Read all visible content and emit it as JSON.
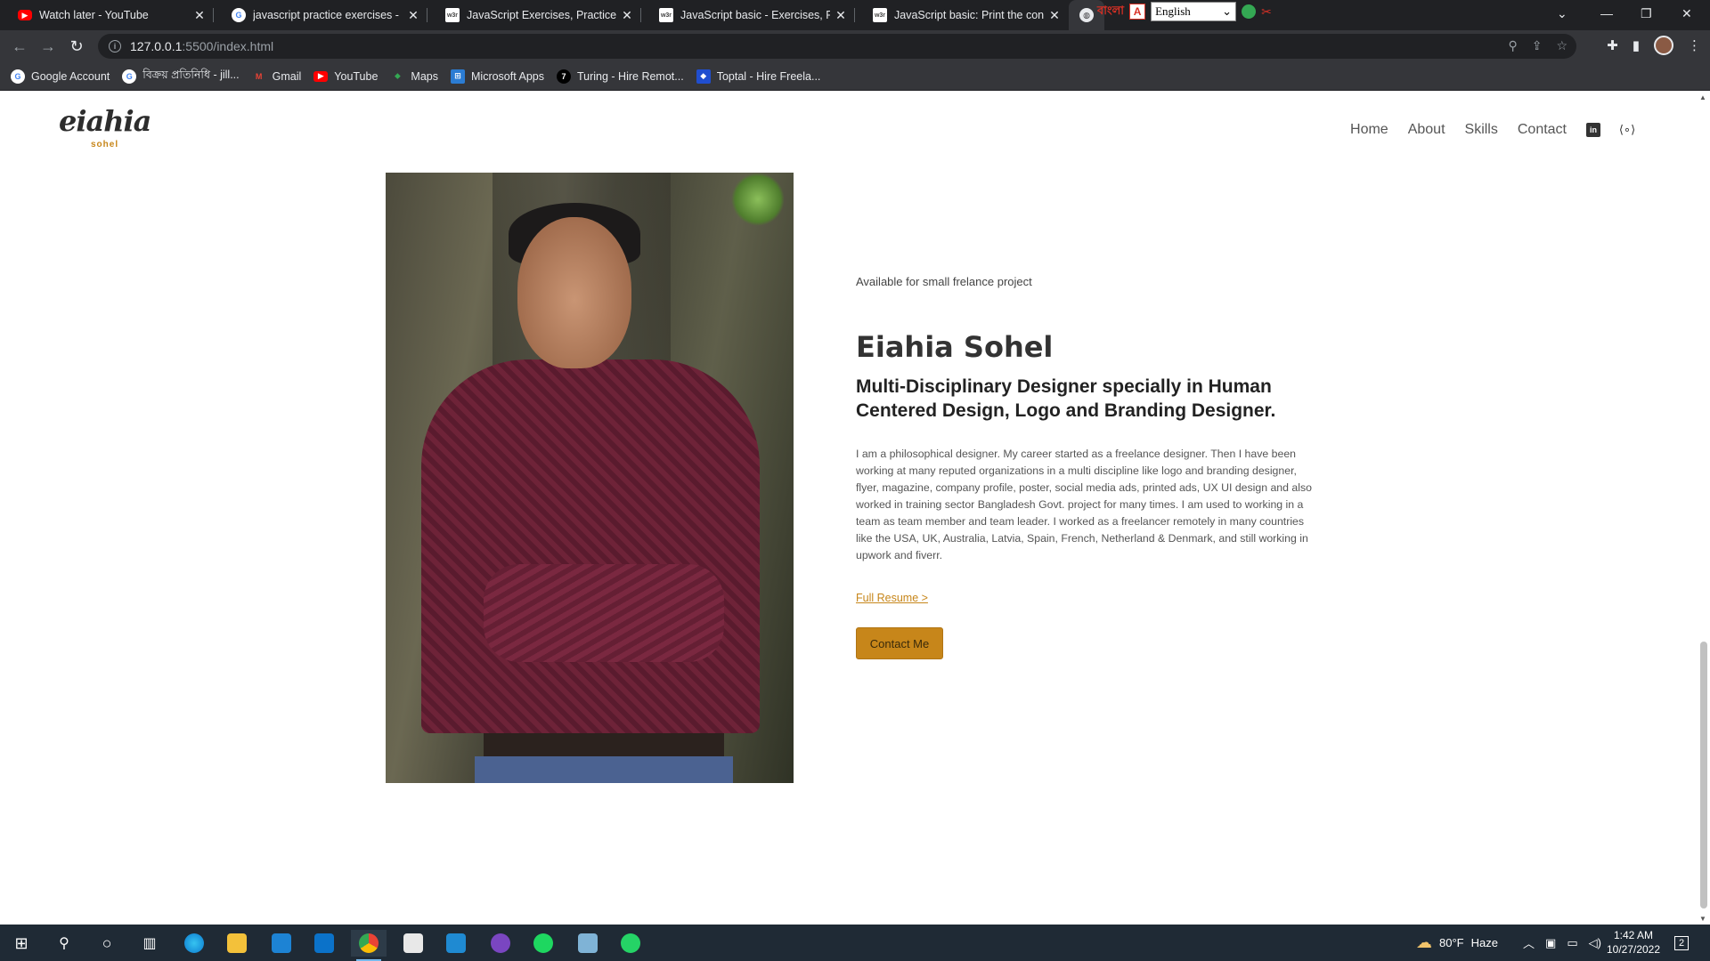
{
  "browser": {
    "tabs": [
      {
        "title": "Watch later - YouTube",
        "icon": "youtube-icon"
      },
      {
        "title": "javascript practice exercises - Go",
        "icon": "google-icon"
      },
      {
        "title": "JavaScript Exercises, Practice, Sol",
        "icon": "w3resource-icon"
      },
      {
        "title": "JavaScript basic - Exercises, Pract",
        "icon": "w3resource-icon"
      },
      {
        "title": "JavaScript basic: Print the conten",
        "icon": "w3resource-icon"
      }
    ],
    "extensions": {
      "bangla_label": "বাংলা",
      "language_select": "English"
    },
    "url_host": "127.0.0.1",
    "url_path": ":5500/index.html",
    "bookmarks": [
      {
        "label": "Google Account",
        "icon": "google-icon",
        "color": "#ffffff"
      },
      {
        "label": "বিক্রয় প্রতিনিধি - jill...",
        "icon": "google-icon",
        "color": "#ffffff"
      },
      {
        "label": "Gmail",
        "icon": "gmail-icon",
        "color": "#ea4335"
      },
      {
        "label": "YouTube",
        "icon": "youtube-icon",
        "color": "#ff0000"
      },
      {
        "label": "Maps",
        "icon": "maps-icon",
        "color": "#34a853"
      },
      {
        "label": "Microsoft Apps",
        "icon": "microsoft-apps-icon",
        "color": "#2b7cd3"
      },
      {
        "label": "Turing - Hire Remot...",
        "icon": "turing-icon",
        "color": "#000000"
      },
      {
        "label": "Toptal - Hire Freela...",
        "icon": "toptal-icon",
        "color": "#204ecf"
      }
    ]
  },
  "site": {
    "logo_main": "eiahia",
    "logo_sub": "sohel",
    "nav": [
      "Home",
      "About",
      "Skills",
      "Contact"
    ],
    "availability": "Available for small frelance project",
    "name": "Eiahia Sohel",
    "tagline": "Multi-Disciplinary Designer specially in Human Centered Design, Logo and Branding Designer.",
    "bio": "I am a philosophical designer. My career started as a freelance designer. Then I have been working at many reputed organizations in a multi discipline like logo and branding designer, flyer, magazine, company profile, poster, social media ads, printed ads, UX UI design and also worked in training sector Bangladesh Govt. project for many times. I am used to working in a team as team member and team leader. I worked as a freelancer remotely in many countries like the USA, UK, Australia, Latvia, Spain, French, Netherland & Denmark, and still working in upwork and fiverr.",
    "resume_link": "Full Resume >",
    "contact_button": "Contact Me",
    "accent_color": "#c7861a"
  },
  "taskbar": {
    "weather_temp": "80°F",
    "weather_desc": "Haze",
    "time": "1:42 AM",
    "date": "10/27/2022",
    "notification_count": "2"
  }
}
